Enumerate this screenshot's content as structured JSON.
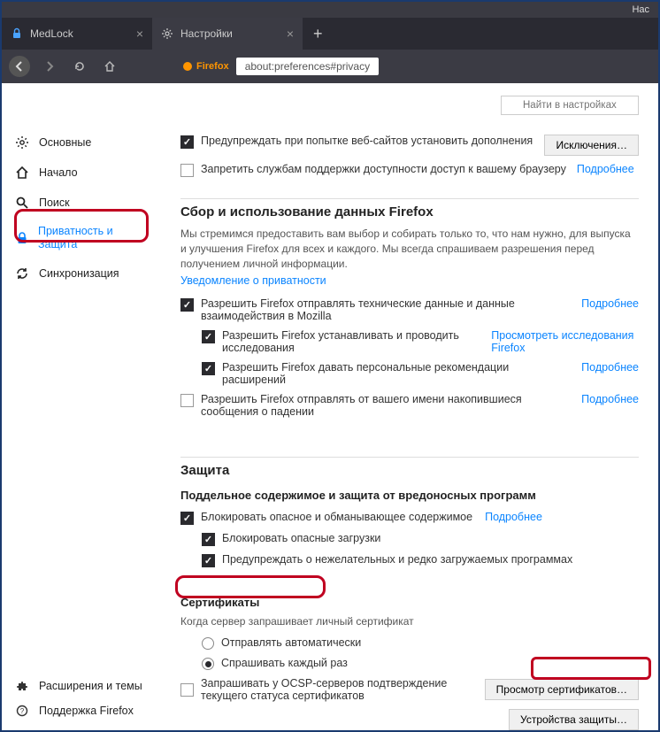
{
  "titlebar": {
    "text": "Нас"
  },
  "tabs": {
    "t1": {
      "label": "MedLock"
    },
    "t2": {
      "label": "Настройки"
    }
  },
  "address": {
    "brand": "Firefox",
    "url": "about:preferences#privacy"
  },
  "search": {
    "placeholder": "Найти в настройках"
  },
  "sidebar": {
    "general": "Основные",
    "home": "Начало",
    "search_label": "Поиск",
    "privacy": "Приватность и Защита",
    "sync": "Синхронизация",
    "ext": "Расширения и темы",
    "support": "Поддержка Firefox"
  },
  "top": {
    "warn_addons": "Предупреждать при попытке веб-сайтов установить дополнения",
    "exceptions_btn": "Исключения…",
    "block_a11y": "Запретить службам поддержки доступности доступ к вашему браузеру",
    "more": "Подробнее"
  },
  "data": {
    "heading": "Сбор и использование данных Firefox",
    "desc": "Мы стремимся предоставить вам выбор и собирать только то, что нам нужно, для выпуска и улучшения Firefox для всех и каждого. Мы всегда спрашиваем разрешения перед получением личной информации.",
    "privacy_notice": "Уведомление о приватности",
    "tech": "Разрешить Firefox отправлять технические данные и данные взаимодействия в Mozilla",
    "studies": "Разрешить Firefox устанавливать и проводить исследования",
    "studies_link": "Просмотреть исследования Firefox",
    "recs": "Разрешить Firefox давать персональные рекомендации расширений",
    "crash": "Разрешить Firefox отправлять от вашего имени накопившиеся сообщения о падении"
  },
  "security": {
    "heading": "Защита",
    "sub": "Поддельное содержимое и защита от вредоносных программ",
    "block_danger": "Блокировать опасное и обманывающее содержимое",
    "block_dl": "Блокировать опасные загрузки",
    "warn_sw": "Предупреждать о нежелательных и редко загружаемых программах"
  },
  "certs": {
    "heading": "Сертификаты",
    "desc": "Когда сервер запрашивает личный сертификат",
    "auto": "Отправлять автоматически",
    "ask": "Спрашивать каждый раз",
    "ocsp": "Запрашивать у OCSP-серверов подтверждение текущего статуса сертификатов",
    "view_btn": "Просмотр сертификатов…",
    "devices_btn": "Устройства защиты…"
  }
}
